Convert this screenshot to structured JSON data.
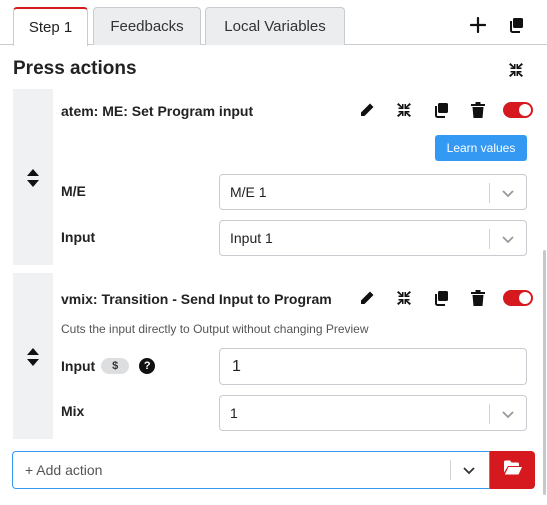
{
  "tabs": [
    {
      "label": "Step 1",
      "active": true
    },
    {
      "label": "Feedbacks",
      "active": false
    },
    {
      "label": "Local Variables",
      "active": false
    }
  ],
  "header": {
    "add_icon": "plus-icon",
    "duplicate_icon": "copy-icon"
  },
  "section": {
    "title": "Press actions",
    "collapse_icon": "compress-icon"
  },
  "actions": [
    {
      "title": "atem: ME: Set Program input",
      "learn_label": "Learn values",
      "enabled": true,
      "fields": [
        {
          "label": "M/E",
          "value": "M/E 1"
        },
        {
          "label": "Input",
          "value": "Input 1"
        }
      ]
    },
    {
      "title": "vmix: Transition - Send Input to Program",
      "description": "Cuts the input directly to Output without changing Preview",
      "enabled": true,
      "fields": [
        {
          "label": "Input",
          "badge": "$",
          "help": "?",
          "value": "1"
        },
        {
          "label": "Mix",
          "value": "1"
        }
      ]
    }
  ],
  "add_action": {
    "placeholder": "+ Add action"
  },
  "colors": {
    "accent_red": "#d6191f",
    "accent_blue": "#3399f3"
  }
}
